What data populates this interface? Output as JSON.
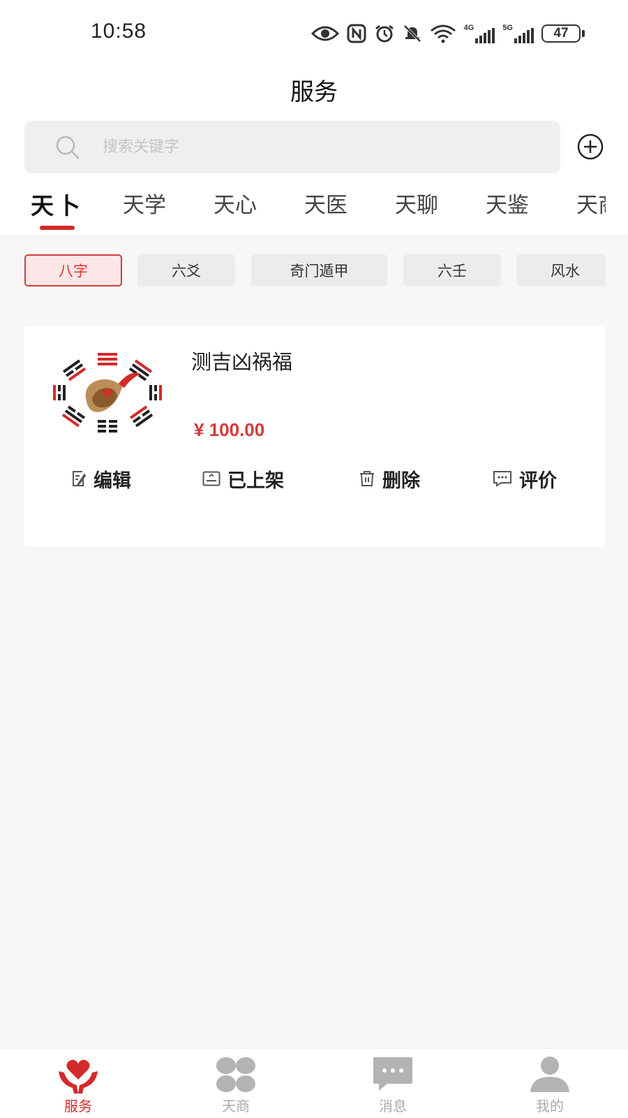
{
  "status_bar": {
    "time": "10:58",
    "network_4g": "4G",
    "network_5g": "5G",
    "battery": "47"
  },
  "header": {
    "title": "服务",
    "search_placeholder": "搜索关键字"
  },
  "main_tabs": [
    "天卜",
    "天学",
    "天心",
    "天医",
    "天聊",
    "天鉴",
    "天商"
  ],
  "active_main_tab": "天卜",
  "sub_tabs": [
    "八字",
    "六爻",
    "奇门遁甲",
    "六壬",
    "风水"
  ],
  "active_sub_tab": "八字",
  "service_card": {
    "title": "测吉凶祸福",
    "price": "¥ 100.00",
    "actions": {
      "edit": "编辑",
      "listed": "已上架",
      "delete": "删除",
      "review": "评价"
    }
  },
  "bottom_nav": {
    "service": "服务",
    "shop": "天商",
    "messages": "消息",
    "mine": "我的"
  },
  "colors": {
    "accent": "#d32a2a",
    "price": "#d63a3a",
    "page_background": "#f7f7f7",
    "inactive_nav": "#aaaaaa"
  },
  "icons": [
    "eye-icon",
    "nfc-icon",
    "alarm-icon",
    "mute-bell-icon",
    "wifi-icon",
    "signal-4g-icon",
    "signal-5g-icon",
    "battery-icon",
    "search-icon",
    "add-circle-icon",
    "bagua-logo",
    "edit-icon",
    "shelf-icon",
    "trash-icon",
    "comment-icon",
    "heart-hands-icon",
    "clover-icon",
    "chat-bubble-icon",
    "person-icon"
  ]
}
